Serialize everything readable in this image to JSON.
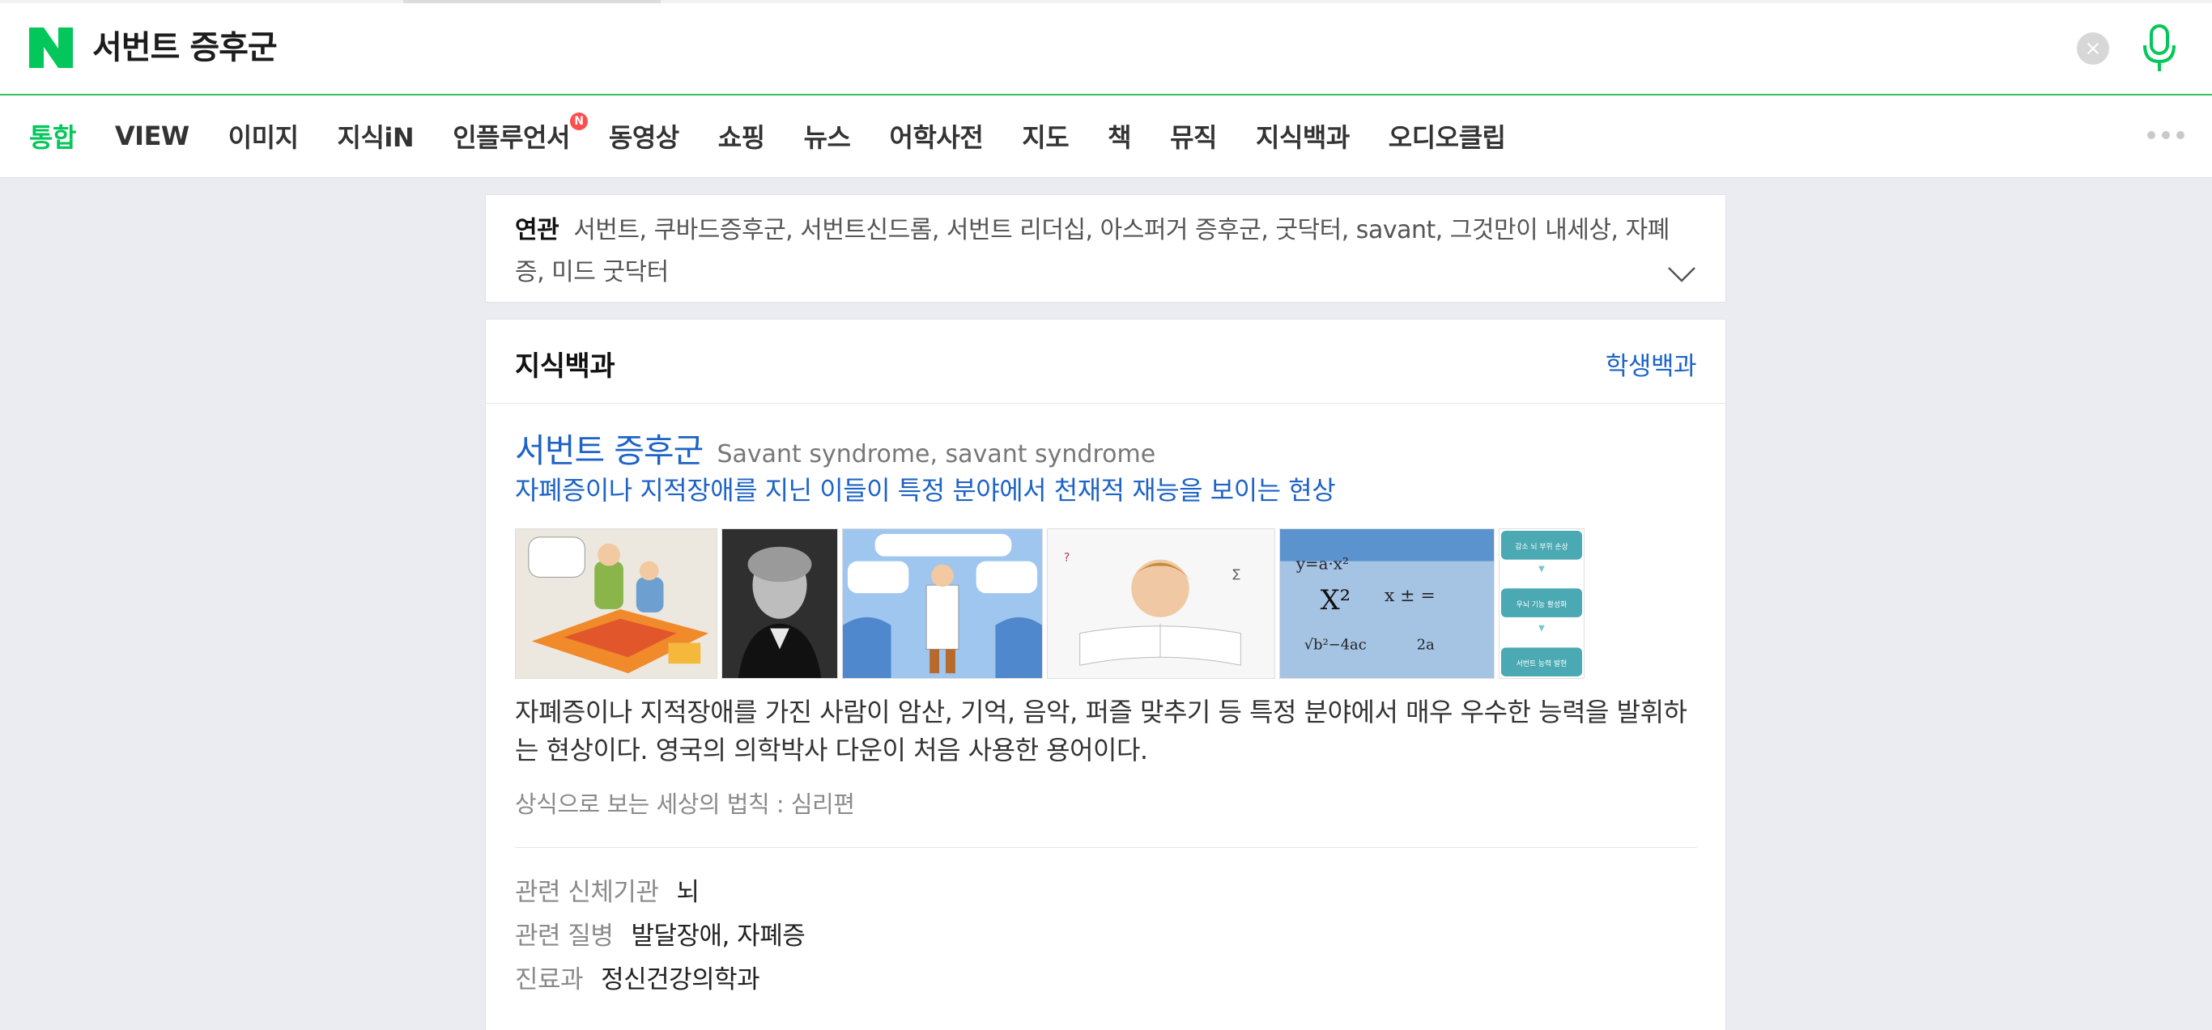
{
  "search": {
    "query": "서번트 증후군"
  },
  "tabs": [
    {
      "label": "통합",
      "active": true
    },
    {
      "label": "VIEW"
    },
    {
      "label": "이미지"
    },
    {
      "label": "지식iN"
    },
    {
      "label": "인플루언서",
      "badge": "N"
    },
    {
      "label": "동영상"
    },
    {
      "label": "쇼핑"
    },
    {
      "label": "뉴스"
    },
    {
      "label": "어학사전"
    },
    {
      "label": "지도"
    },
    {
      "label": "책"
    },
    {
      "label": "뮤직"
    },
    {
      "label": "지식백과"
    },
    {
      "label": "오디오클립"
    }
  ],
  "related": {
    "label": "연관",
    "text": "서번트, 쿠바드증후군, 서번트신드롬, 서번트 리더십, 아스퍼거 증후군, 굿닥터, savant, 그것만이 내세상, 자폐증, 미드 굿닥터"
  },
  "knowledge": {
    "section_title": "지식백과",
    "section_link": "학생백과",
    "entry_title": "서번트 증후군",
    "entry_title_en": "Savant syndrome, savant syndrome",
    "entry_subtitle": "자폐증이나 지적장애를 지닌 이들이 특정 분야에서 천재적 재능을 보이는 현상",
    "thumb_texts": {
      "flow1": "감소 뇌 부위 손상",
      "flow2": "우뇌 기능 활성화",
      "flow3": "서번트 능력 발현"
    },
    "description": "자폐증이나 지적장애를 가진 사람이 암산, 기억, 음악, 퍼즐 맞추기 등 특정 분야에서 매우 우수한 능력을 발휘하는 현상이다. 영국의 의학박사 다운이 처음 사용한 용어이다.",
    "source": "상식으로 보는 세상의 법칙 : 심리편",
    "info": [
      {
        "key": "관련 신체기관",
        "value": "뇌"
      },
      {
        "key": "관련 질병",
        "value": "발달장애, 자폐증"
      },
      {
        "key": "진료과",
        "value": "정신건강의학과"
      }
    ]
  },
  "colors": {
    "brand_green": "#03c75a",
    "link_blue": "#1e63c6",
    "background": "#eaecf1"
  },
  "icons": [
    "naver-logo-icon",
    "clear-icon",
    "mic-icon",
    "new-badge-icon",
    "more-icon",
    "chevron-down-icon"
  ]
}
